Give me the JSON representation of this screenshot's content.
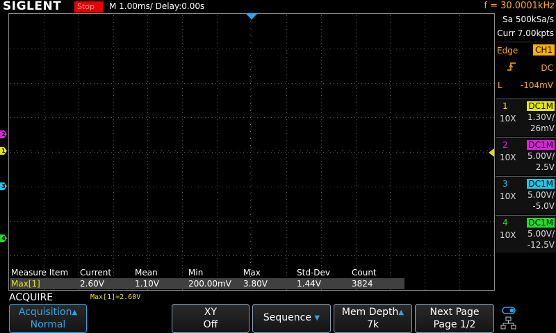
{
  "topbar": {
    "logo": "SIGLENT",
    "run_status": "Stop",
    "timebase": "M 1.00ms/ Delay:0.00s",
    "frequency": "f = 30.0001kHz"
  },
  "right_panel": {
    "sample_rate": "Sa 500kSa/s",
    "memory": "Curr 7.00kpts",
    "trigger": {
      "type": "Edge",
      "source": "CH1",
      "slope_icon": "rising-edge-icon",
      "coupling": "DC",
      "level_label": "L",
      "level": "-104mV"
    },
    "channels": [
      {
        "num": "1",
        "probe": "10X",
        "coupling": "DC1M",
        "scale": "1.30V/",
        "offset": "26mV",
        "color": "#e8e800"
      },
      {
        "num": "2",
        "probe": "10X",
        "coupling": "DC1M",
        "scale": "5.00V/",
        "offset": "2.5V",
        "color": "#e020e0"
      },
      {
        "num": "3",
        "probe": "10X",
        "coupling": "DC1M",
        "scale": "5.00V/",
        "offset": "-5.0V",
        "color": "#20c8e8"
      },
      {
        "num": "4",
        "probe": "10X",
        "coupling": "DC1M",
        "scale": "5.00V/",
        "offset": "-12.5V",
        "color": "#20e020"
      }
    ]
  },
  "markers": {
    "ch1": "1",
    "ch2": "2",
    "ch3": "3",
    "ch4": "4"
  },
  "measure": {
    "headers": [
      "Measure Item",
      "Current",
      "Mean",
      "Min",
      "Max",
      "Std-Dev",
      "Count"
    ],
    "row": [
      "Max[1]",
      "2.60V",
      "1.10V",
      "200.00mV",
      "3.80V",
      "1.44V",
      "3824"
    ]
  },
  "acquire": {
    "title": "ACQUIRE",
    "readout": "Max[1]=2.60V"
  },
  "softkeys": {
    "acquisition": {
      "line1": "Acquisition",
      "line2": "Normal"
    },
    "xy": {
      "line1": "XY",
      "line2": "Off"
    },
    "sequence": {
      "label": "Sequence"
    },
    "mem_depth": {
      "line1": "Mem Depth",
      "line2": "7k"
    },
    "next_page": {
      "line1": "Next Page",
      "line2": "Page 1/2"
    }
  },
  "colors": {
    "ch1": "#e8e800",
    "ch2": "#e020e0",
    "ch3": "#20c8e8",
    "ch4": "#20e020",
    "accent": "#2aa7e8",
    "trigger": "#ffb000",
    "stop": "#e60000"
  }
}
